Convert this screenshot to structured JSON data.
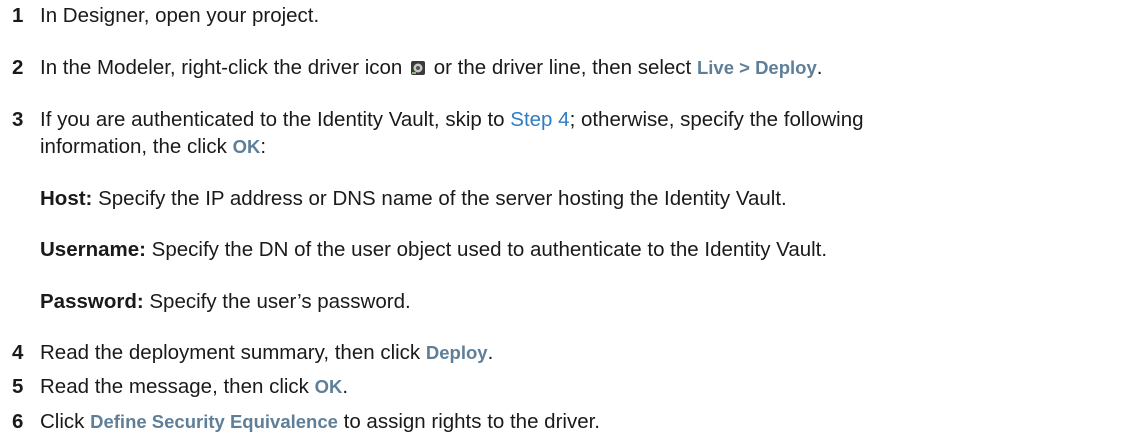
{
  "steps": [
    {
      "num": "1",
      "text": "In Designer, open your project."
    },
    {
      "num": "2",
      "pre": "In the Modeler, right-click the driver icon",
      "mid": "or the driver line, then select",
      "ui": "Live > Deploy",
      "post": "."
    },
    {
      "num": "3",
      "pre": "If you are authenticated to the Identity Vault, skip to",
      "link": "Step 4",
      "post": "; otherwise, specify the following",
      "line2_pre": "information, the click",
      "line2_ui": "OK",
      "line2_post": ":"
    },
    {
      "num": "4",
      "pre": "Read the deployment summary, then click",
      "ui": "Deploy",
      "post": "."
    },
    {
      "num": "5",
      "pre": "Read the message, then click",
      "ui": "OK",
      "post": "."
    },
    {
      "num": "6",
      "pre": "Click",
      "ui": "Define Security Equivalence",
      "post": "to assign rights to the driver."
    }
  ],
  "fields": [
    {
      "label": "Host:",
      "text": "Specify the IP address or DNS name of the server hosting the Identity Vault."
    },
    {
      "label": "Username:",
      "text": "Specify the DN of the user object used to authenticate to the Identity Vault."
    },
    {
      "label": "Password:",
      "text": "Specify the user’s password."
    }
  ],
  "colors": {
    "ui_text": "#5f7f99",
    "link": "#2f7dc2",
    "body_text": "#1a1a1a"
  },
  "icons": {
    "driver": "driver-icon"
  }
}
